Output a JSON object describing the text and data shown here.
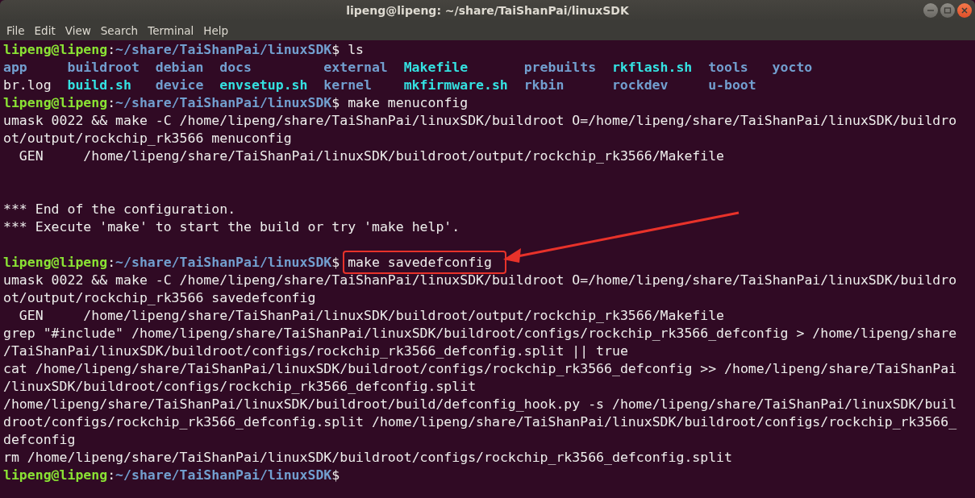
{
  "window": {
    "title": "lipeng@lipeng: ~/share/TaiShanPai/linuxSDK"
  },
  "menu": [
    "File",
    "Edit",
    "View",
    "Search",
    "Terminal",
    "Help"
  ],
  "lines": [
    {
      "kind": "prompt",
      "segments": [
        {
          "kind": "user",
          "text": "lipeng@lipeng"
        },
        {
          "kind": "plain",
          "text": ":"
        },
        {
          "kind": "path",
          "text": "~/share/TaiShanPai/linuxSDK"
        },
        {
          "kind": "plain",
          "text": "$ "
        },
        {
          "kind": "plain",
          "text": "ls"
        }
      ]
    },
    {
      "kind": "listing",
      "entries": [
        {
          "kind": "dir",
          "text": "app"
        },
        {
          "kind": "dir",
          "text": "buildroot"
        },
        {
          "kind": "dir",
          "text": "debian"
        },
        {
          "kind": "dir",
          "text": "docs"
        },
        {
          "kind": "dir",
          "text": "external"
        },
        {
          "kind": "exec",
          "text": "Makefile"
        },
        {
          "kind": "dir",
          "text": "prebuilts"
        },
        {
          "kind": "exec",
          "text": "rkflash.sh"
        },
        {
          "kind": "dir",
          "text": "tools"
        },
        {
          "kind": "dir",
          "text": "yocto"
        }
      ]
    },
    {
      "kind": "listing",
      "entries": [
        {
          "kind": "file",
          "text": "br.log"
        },
        {
          "kind": "exec",
          "text": "build.sh"
        },
        {
          "kind": "dir",
          "text": "device"
        },
        {
          "kind": "exec",
          "text": "envsetup.sh"
        },
        {
          "kind": "dir",
          "text": "kernel"
        },
        {
          "kind": "exec",
          "text": "mkfirmware.sh"
        },
        {
          "kind": "dir",
          "text": "rkbin"
        },
        {
          "kind": "dir",
          "text": "rockdev"
        },
        {
          "kind": "dir",
          "text": "u-boot"
        }
      ]
    },
    {
      "kind": "prompt",
      "segments": [
        {
          "kind": "user",
          "text": "lipeng@lipeng"
        },
        {
          "kind": "plain",
          "text": ":"
        },
        {
          "kind": "path",
          "text": "~/share/TaiShanPai/linuxSDK"
        },
        {
          "kind": "plain",
          "text": "$ "
        },
        {
          "kind": "plain",
          "text": "make menuconfig"
        }
      ]
    },
    {
      "kind": "output",
      "text": "umask 0022 && make -C /home/lipeng/share/TaiShanPai/linuxSDK/buildroot O=/home/lipeng/share/TaiShanPai/linuxSDK/buildro"
    },
    {
      "kind": "output",
      "text": "ot/output/rockchip_rk3566 menuconfig"
    },
    {
      "kind": "output",
      "text": "  GEN     /home/lipeng/share/TaiShanPai/linuxSDK/buildroot/output/rockchip_rk3566/Makefile"
    },
    {
      "kind": "blank"
    },
    {
      "kind": "blank"
    },
    {
      "kind": "output",
      "text": "*** End of the configuration."
    },
    {
      "kind": "output",
      "text": "*** Execute 'make' to start the build or try 'make help'."
    },
    {
      "kind": "blank"
    },
    {
      "kind": "prompt",
      "segments": [
        {
          "kind": "user",
          "text": "lipeng@lipeng"
        },
        {
          "kind": "plain",
          "text": ":"
        },
        {
          "kind": "path",
          "text": "~/share/TaiShanPai/linuxSDK"
        },
        {
          "kind": "plain",
          "text": "$ "
        },
        {
          "kind": "plain",
          "text": "make savedefconfig",
          "highlighted": true
        }
      ]
    },
    {
      "kind": "output",
      "text": "umask 0022 && make -C /home/lipeng/share/TaiShanPai/linuxSDK/buildroot O=/home/lipeng/share/TaiShanPai/linuxSDK/buildro"
    },
    {
      "kind": "output",
      "text": "ot/output/rockchip_rk3566 savedefconfig"
    },
    {
      "kind": "output",
      "text": "  GEN     /home/lipeng/share/TaiShanPai/linuxSDK/buildroot/output/rockchip_rk3566/Makefile"
    },
    {
      "kind": "output",
      "text": "grep \"#include\" /home/lipeng/share/TaiShanPai/linuxSDK/buildroot/configs/rockchip_rk3566_defconfig > /home/lipeng/share"
    },
    {
      "kind": "output",
      "text": "/TaiShanPai/linuxSDK/buildroot/configs/rockchip_rk3566_defconfig.split || true"
    },
    {
      "kind": "output",
      "text": "cat /home/lipeng/share/TaiShanPai/linuxSDK/buildroot/configs/rockchip_rk3566_defconfig >> /home/lipeng/share/TaiShanPai"
    },
    {
      "kind": "output",
      "text": "/linuxSDK/buildroot/configs/rockchip_rk3566_defconfig.split"
    },
    {
      "kind": "output",
      "text": "/home/lipeng/share/TaiShanPai/linuxSDK/buildroot/build/defconfig_hook.py -s /home/lipeng/share/TaiShanPai/linuxSDK/buil"
    },
    {
      "kind": "output",
      "text": "droot/configs/rockchip_rk3566_defconfig.split /home/lipeng/share/TaiShanPai/linuxSDK/buildroot/configs/rockchip_rk3566_"
    },
    {
      "kind": "output",
      "text": "defconfig"
    },
    {
      "kind": "output",
      "text": "rm /home/lipeng/share/TaiShanPai/linuxSDK/buildroot/configs/rockchip_rk3566_defconfig.split"
    },
    {
      "kind": "prompt",
      "segments": [
        {
          "kind": "user",
          "text": "lipeng@lipeng"
        },
        {
          "kind": "plain",
          "text": ":"
        },
        {
          "kind": "path",
          "text": "~/share/TaiShanPai/linuxSDK"
        },
        {
          "kind": "plain",
          "text": "$"
        }
      ]
    }
  ]
}
